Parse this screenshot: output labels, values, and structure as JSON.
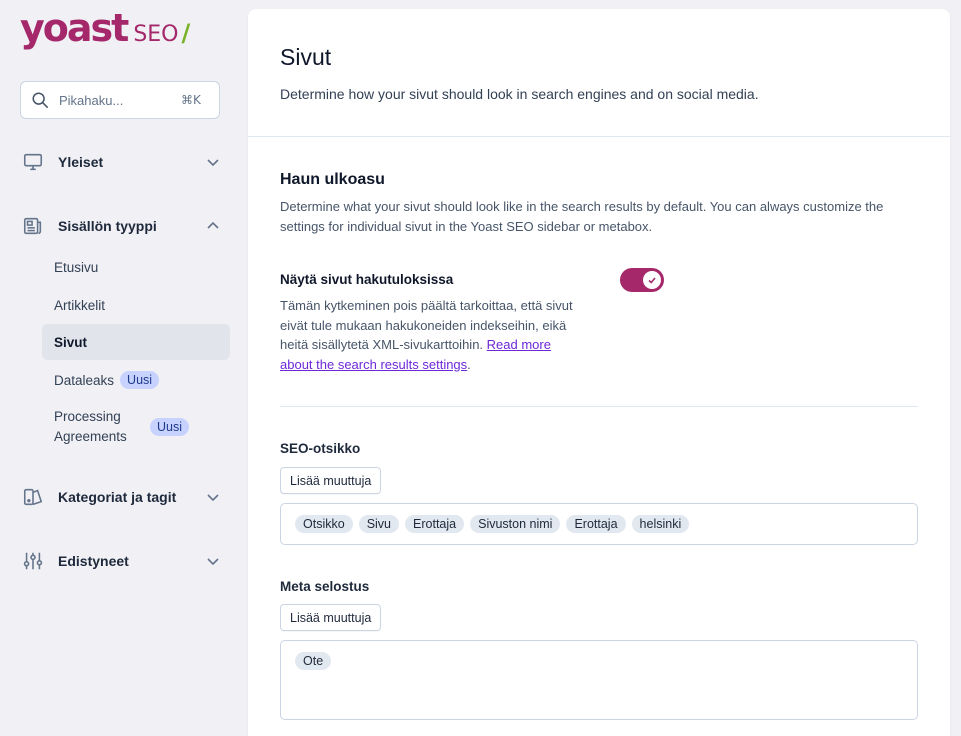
{
  "brand": {
    "name": "yoast",
    "product": "SEO",
    "slash": "/"
  },
  "colors": {
    "brand": "#a4286a",
    "accent_green": "#77b227",
    "badge_bg": "#c7d2fe"
  },
  "search": {
    "placeholder": "Pikahaku...",
    "shortcut": "⌘K"
  },
  "sidebar": {
    "groups": [
      {
        "label": "Yleiset",
        "icon": "desktop-icon",
        "expanded": false
      },
      {
        "label": "Sisällön tyyppi",
        "icon": "newspaper-icon",
        "expanded": true
      },
      {
        "label": "Kategoriat ja tagit",
        "icon": "tag-icon",
        "expanded": false
      },
      {
        "label": "Edistyneet",
        "icon": "sliders-icon",
        "expanded": false
      }
    ],
    "content_types": [
      {
        "label": "Etusivu"
      },
      {
        "label": "Artikkelit"
      },
      {
        "label": "Sivut",
        "active": true
      },
      {
        "label": "Dataleaks",
        "badge": "Uusi"
      },
      {
        "label": "Processing Agreements",
        "badge": "Uusi"
      }
    ]
  },
  "main": {
    "title": "Sivut",
    "description": "Determine how your sivut should look in search engines and on social media.",
    "search_appearance": {
      "title": "Haun ulkoasu",
      "description": "Determine what your sivut should look like in the search results by default. You can always customize the settings for individual sivut in the Yoast SEO sidebar or metabox.",
      "toggle": {
        "label": "Näytä sivut hakutuloksissa",
        "enabled": true,
        "description": "Tämän kytkeminen pois päältä tarkoittaa, että sivut eivät tule mukaan hakukoneiden indekseihin, eikä heitä sisällytetä XML-sivukarttoihin.",
        "link_text": "Read more about the search results settings",
        "after_link": "."
      }
    },
    "seo_title": {
      "label": "SEO-otsikko",
      "button": "Lisää muuttuja",
      "variables": [
        "Otsikko",
        "Sivu",
        "Erottaja",
        "Sivuston nimi",
        "Erottaja",
        "helsinki"
      ]
    },
    "meta_description": {
      "label": "Meta selostus",
      "button": "Lisää muuttuja",
      "variables": [
        "Ote"
      ]
    }
  }
}
